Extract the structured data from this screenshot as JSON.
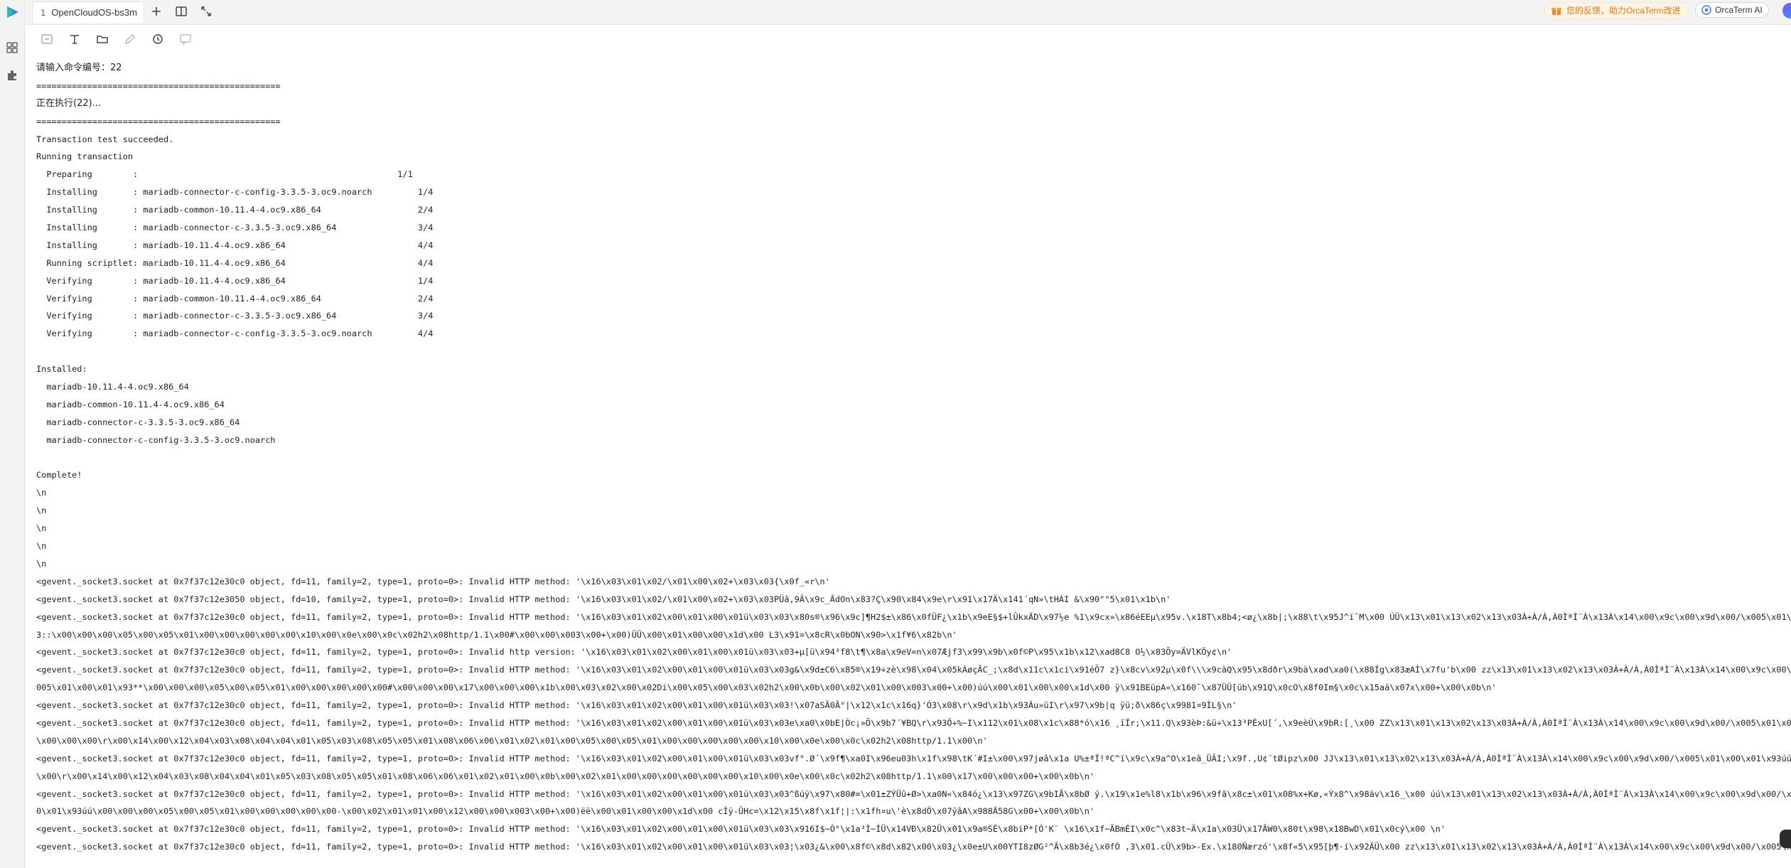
{
  "tab": {
    "index": "1",
    "title": "OpenCloudOS-bs3m"
  },
  "header": {
    "feedback_label": "您的反馈，助力OrcaTerm改进",
    "ai_label": "OrcaTerm AI"
  },
  "icons": {
    "logo": "orcaterm-logo-icon",
    "rail": [
      "grid-icon",
      "puzzle-icon"
    ],
    "tab_actions": [
      "add-tab-icon",
      "split-view-icon",
      "expand-icon"
    ],
    "toolbar": [
      "select-icon",
      "text-format-icon",
      "folder-icon",
      "edit-icon",
      "refresh-icon",
      "chat-icon"
    ]
  },
  "colors": {
    "accent": "#3a7afe",
    "feedback": "#e8740f"
  },
  "terminal": {
    "lines": [
      "请输入命令编号：22",
      "================================================",
      "正在执行(22)...",
      "================================================",
      "Transaction test succeeded.",
      "Running transaction",
      "  Preparing        :                                                   1/1",
      "  Installing       : mariadb-connector-c-config-3.3.5-3.oc9.noarch         1/4",
      "  Installing       : mariadb-common-10.11.4-4.oc9.x86_64                   2/4",
      "  Installing       : mariadb-connector-c-3.3.5-3.oc9.x86_64                3/4",
      "  Installing       : mariadb-10.11.4-4.oc9.x86_64                          4/4",
      "  Running scriptlet: mariadb-10.11.4-4.oc9.x86_64                          4/4",
      "  Verifying        : mariadb-10.11.4-4.oc9.x86_64                          1/4",
      "  Verifying        : mariadb-common-10.11.4-4.oc9.x86_64                   2/4",
      "  Verifying        : mariadb-connector-c-3.3.5-3.oc9.x86_64                3/4",
      "  Verifying        : mariadb-connector-c-config-3.3.5-3.oc9.noarch         4/4",
      "",
      "Installed:",
      "  mariadb-10.11.4-4.oc9.x86_64",
      "  mariadb-common-10.11.4-4.oc9.x86_64",
      "  mariadb-connector-c-3.3.5-3.oc9.x86_64",
      "  mariadb-connector-c-config-3.3.5-3.oc9.noarch",
      "",
      "Complete!",
      "\\n",
      "\\n",
      "\\n",
      "\\n",
      "\\n",
      "<gevent._socket3.socket at 0x7f37c12e30c0 object, fd=11, family=2, type=1, proto=0>: Invalid HTTP method: '\\x16\\x03\\x01\\x02/\\x01\\x00\\x02+\\x03\\x03{\\x0f_«r\\n'",
      "<gevent._socket3.socket at 0x7f37c12e3050 object, fd=10, family=2, type=1, proto=0>: Invalid HTTP method: '\\x16\\x03\\x01\\x02/\\x01\\x00\\x02+\\x03\\x03PÜâ,9Ä\\x9c_ÃdOn\\x83?Ç\\x90\\x84\\x9e\\r\\x91\\x17Ä\\x141´qN»\\tHÁI &\\x90\"\"5\\x01\\x1b\\n'",
      "<gevent._socket3.socket at 0x7f37c12e30c0 object, fd=11, family=2, type=1, proto=0>: Invalid HTTP method: '\\x16\\x03\\x01\\x02\\x00\\x01\\x00\\x01ü\\x03\\x03\\x80s®\\x96\\x9c]¶H2$±\\x86\\x0fÜF¿\\x1b\\x9eE§$+lÛkxÃD\\x97½e %1\\x9cx»\\x86éEEµ\\x95v.\\x18T\\x8b4;<ø¿\\x8b|;\\x88\\t\\x95J^í¯M\\x00 ÚÜ\\x13\\x01\\x13\\x02\\x13\\x03À+À/À,À0ÌªÌ¨À\\x13À\\x14\\x00\\x9c\\x00\\x9d\\x00/\\x005\\x01\\x00\\x01",
      "3::\\x00\\x00\\x00\\x05\\x00\\x05\\x01\\x00\\x00\\x00\\x00\\x00\\x10\\x00\\x0e\\x00\\x0c\\x02h2\\x08http/1.1\\x00#\\x00\\x00\\x003\\x00+\\x00)ÜÜ\\x00\\x01\\x00\\x00\\x1d\\x00 L3\\x91=\\x8cR\\x0bON\\x90>\\x1f¥6\\x82b\\n'",
      "<gevent._socket3.socket at 0x7f37c12e30c0 object, fd=11, family=2, type=1, proto=0>: Invalid http version: '\\x16\\x03\\x01\\x02\\x00\\x01\\x00\\x01ü\\x03\\x03+µ[ü\\x94³f8\\t¶\\x8a\\x9eV=n\\x07Æjf3\\x99\\x9b\\x0f©P\\x95\\x1b\\x12\\xad8C8 O½\\x83Õy=ÄVlKÖy¢\\n'",
      "<gevent._socket3.socket at 0x7f37c12e30c0 object, fd=11, family=2, type=1, proto=0>: Invalid HTTP method: '\\x16\\x03\\x01\\x02\\x00\\x01\\x00\\x01ü\\x03\\x03g&\\x9d±C6\\x85®\\x19÷zè\\x98\\x04\\x05kÁøçÂC_;\\x8d\\x11c\\x1cí\\x91éÕ7 z}\\x8cv\\x92µ\\x0f\\\\\\x9càQ\\x95\\x8dðr\\x9bà\\xad\\xa0(\\x88Íg\\x83æAÌ\\x7fu'b\\x00 zz\\x13\\x01\\x13\\x02\\x13\\x03À+À/À,À0ÌªÌ¨À\\x13À\\x14\\x00\\x9c\\x00\\x9d\\x00",
      "005\\x01\\x00\\x01\\x93**\\x00\\x00\\x00\\x05\\x00\\x05\\x01\\x00\\x00\\x00\\x00\\x00#\\x00\\x00\\x00\\x17\\x00\\x00\\x00\\x1b\\x00\\x03\\x02\\x00\\x02Di\\x00\\x05\\x00\\x03\\x02h2\\x00\\x0b\\x00\\x02\\x01\\x00\\x003\\x00+\\x00)úú\\x00\\x01\\x00\\x00\\x1d\\x00 ÿ\\x91BEüpA«\\x160¯\\x87ÜÜ[üb\\x91Q\\x0cO\\x8f0Im§\\x0c\\x15aä\\x07x\\x00+\\x00\\x0b\\n'",
      "<gevent._socket3.socket at 0x7f37c12e30c0 object, fd=11, family=2, type=1, proto=0>: Invalid HTTP method: '\\x16\\x03\\x01\\x02\\x00\\x01\\x00\\x01ü\\x03\\x03!\\x07aSÄ0Ã°|\\x12\\x1c\\x16q}'Ó3\\x08\\r\\x9d\\x1b\\x93Áu»üI\\r\\x97\\x9b|q ÿü;ð\\x86ç\\x9981¤9ÌL§\\n'",
      "<gevent._socket3.socket at 0x7f37c12e30c0 object, fd=11, family=2, type=1, proto=0>: Invalid HTTP method: '\\x16\\x03\\x01\\x02\\x00\\x01\\x00\\x01ü\\x03\\x03e\\xa0\\x0bE|Òc¡»Õ\\x9b7´¥BQ\\r\\x93Ô÷%~I\\x112\\x01\\x08\\x1c\\x88*ó\\x16 ¸ïÏr;\\x11.Q\\x93èÞ:&ü÷\\x13³PÉxU[´,\\x9eèÚ\\x9bR:[¸\\x00 ZZ\\x13\\x01\\x13\\x02\\x13\\x03À+À/À,À0ÌªÌ¨À\\x13À\\x14\\x00\\x9c\\x00\\x9d\\x00/\\x005\\x01\\x00\\x01",
      "\\x00\\x00\\x00\\r\\x00\\x14\\x00\\x12\\x04\\x03\\x08\\x04\\x04\\x01\\x05\\x03\\x08\\x05\\x05\\x01\\x08\\x06\\x06\\x01\\x02\\x01\\x00\\x05\\x00\\x05\\x01\\x00\\x00\\x00\\x00\\x00\\x10\\x00\\x0e\\x00\\x0c\\x02h2\\x08http/1.1\\x00\\n'",
      "<gevent._socket3.socket at 0x7f37c12e30c0 object, fd=11, family=2, type=1, proto=0>: Invalid HTTP method: '\\x16\\x03\\x01\\x02\\x00\\x01\\x00\\x01ü\\x03\\x03vf°.Ø´\\x9f¶\\xa0I\\x96eu03h\\x1f\\x98\\tK´#I±\\x00\\x97jøâ\\x1a U%±ªÍ!ªC^ï\\x9c\\x9a^O\\x1eã_ÜÂI;\\x9f.,U¢´tØipz\\x00 JJ\\x13\\x01\\x13\\x02\\x13\\x03À+À/À,À0ÌªÌ¨À\\x13À\\x14\\x00\\x9c\\x00\\x9d\\x00/\\x005\\x01\\x00\\x01\\x93úú\\x00\\x00",
      "\\x00\\r\\x00\\x14\\x00\\x12\\x04\\x03\\x08\\x04\\x04\\x01\\x05\\x03\\x08\\x05\\x05\\x01\\x08\\x06\\x06\\x01\\x02\\x01\\x00\\x0b\\x00\\x02\\x01\\x00\\x00\\x00\\x00\\x00\\x00\\x10\\x00\\x0e\\x00\\x0c\\x02h2\\x08http/1.1\\x00\\x17\\x00\\x00\\x00+\\x00\\x0b\\n'",
      "<gevent._socket3.socket at 0x7f37c12e30c0 object, fd=11, family=2, type=1, proto=0>: Invalid HTTP method: '\\x16\\x03\\x01\\x02\\x00\\x01\\x00\\x01ü\\x03\\x03^ßúÿ\\x97\\x80#=\\x01±ZÝÜû+Ø>\\xa0N«\\x84ó¿\\x13\\x97ZG\\x9bIÃ\\x8bØ ý.\\x19\\x1e%l8\\x1b\\x96\\x9fã\\x8c±\\x01\\x08%x+Kø,«Ýx8^\\x98äv\\x16_\\x00 úú\\x13\\x01\\x13\\x02\\x13\\x03À+À/À,À0ÌªÌ¨À\\x13À\\x14\\x00\\x9c\\x00\\x9d\\x00/\\x005\\x01\\x00\\x01",
      "0\\x01\\x93úú\\x00\\x00\\x00\\x05\\x00\\x05\\x01\\x00\\x00\\x00\\x00\\x00-\\x00\\x02\\x01\\x01\\x00\\x12\\x00\\x00\\x003\\x00+\\x00)ëë\\x00\\x01\\x00\\x00\\x1d\\x00 cÍÿ-ÛHc=\\x12\\x15\\x8f\\x1f¦|:\\x1fh¤u\\'è\\x8dÖ\\x07ÿâA\\x988Ã58G\\x00+\\x00\\x0b\\n'",
      "<gevent._socket3.socket at 0x7f37c12e30c0 object, fd=11, family=2, type=1, proto=0>: Invalid HTTP method: '\\x16\\x03\\x01\\x02\\x00\\x01\\x00\\x01ü\\x03\\x03\\x916I$~Ò°\\x1a³Ì~ÍÜ\\x14VÐ\\x82Ü\\x01\\x9a®SÉ\\x8biP*[Ó'K¨ \\x16\\x1f~ÃBmÉI\\x0c^\\x83t~Ä\\x1a\\x03Ü\\x17ÃW0\\x80t\\x98\\x18BwD\\x01\\x0cý\\x00 \\n'",
      "<gevent._socket3.socket at 0x7f37c12e30c0 object, fd=11, family=2, type=1, proto=0>: Invalid HTTP method: '\\x16\\x03\\x01\\x02\\x00\\x01\\x00\\x01ü\\x03\\x03¦\\x03¿&\\x00\\x8f©\\x8d\\x82\\x00\\x03¿\\x0e±U\\x00YTI8zØG²^Ã\\x8b3é¿\\x0fÒ ,3\\x01.cÜ\\x9b>-Ex.\\x180Ñærzó'\\x8f«5\\x95[þ¶·í\\x92ÄÜ\\x00 zz\\x13\\x01\\x13\\x02\\x13\\x03À+À/À,À0ÌªÌ¨À\\x13À\\x14\\x00\\x9c\\x00\\x9d\\x00/\\x005\\x01\\x00\\x01"
    ]
  }
}
